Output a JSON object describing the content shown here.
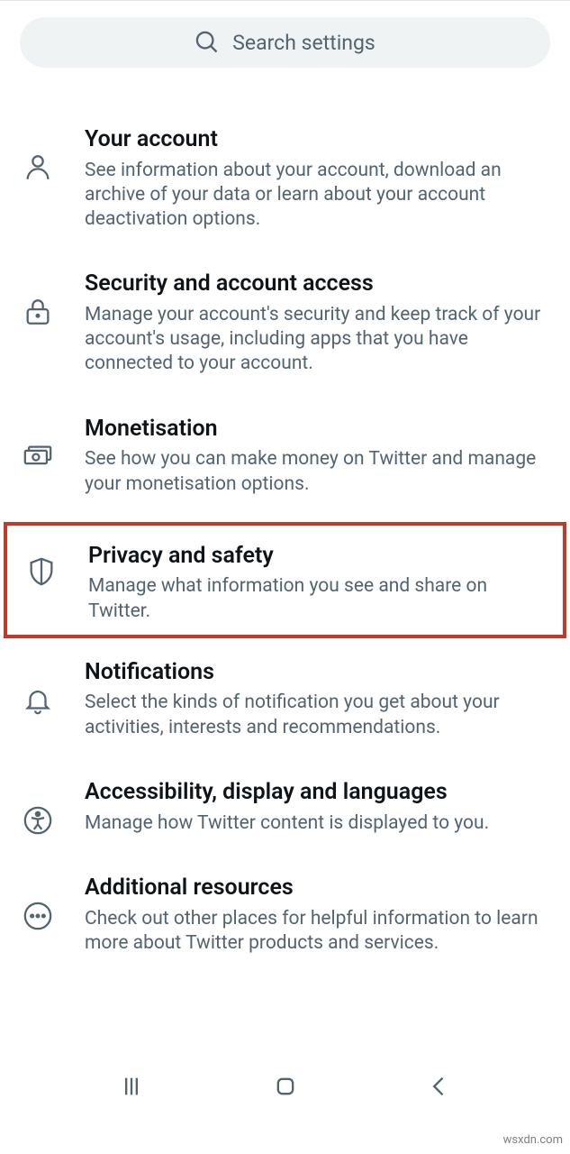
{
  "search": {
    "placeholder": "Search settings"
  },
  "items": [
    {
      "title": "Your account",
      "desc": "See information about your account, download an archive of your data or learn about your account deactivation options."
    },
    {
      "title": "Security and account access",
      "desc": "Manage your account's security and keep track of your account's usage, including apps that you have connected to your account."
    },
    {
      "title": "Monetisation",
      "desc": "See how you can make money on Twitter and manage your monetisation options."
    },
    {
      "title": "Privacy and safety",
      "desc": "Manage what information you see and share on Twitter."
    },
    {
      "title": "Notifications",
      "desc": "Select the kinds of notification you get about your activities, interests and recommendations."
    },
    {
      "title": "Accessibility, display and languages",
      "desc": "Manage how Twitter content is displayed to you."
    },
    {
      "title": "Additional resources",
      "desc": "Check out other places for helpful information to learn more about Twitter products and services."
    }
  ],
  "watermark": "wsxdn.com"
}
